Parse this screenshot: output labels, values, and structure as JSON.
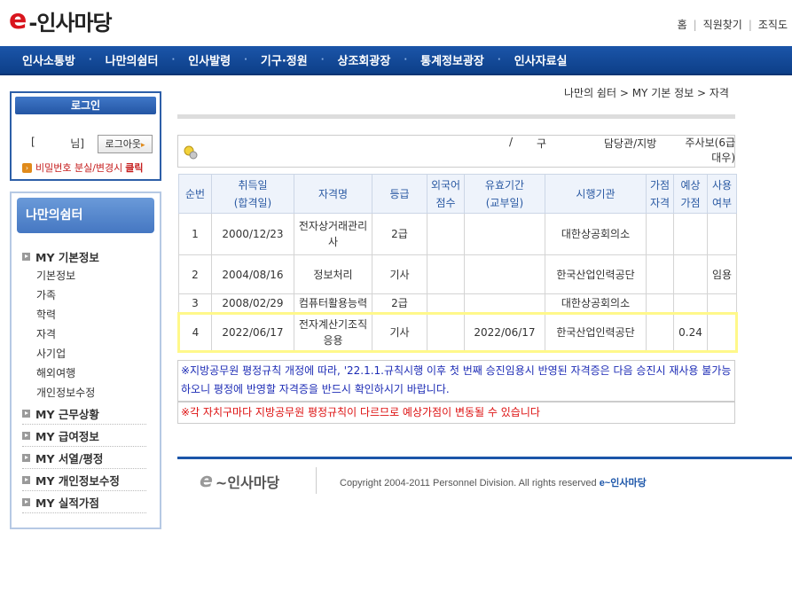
{
  "header": {
    "logo_e": "e",
    "logo_text": "-인사마당",
    "links": [
      "홈",
      "직원찾기",
      "조직도"
    ]
  },
  "gnb": [
    "인사소통방",
    "나만의쉼터",
    "인사발령",
    "기구·정원",
    "상조회광장",
    "통계정보광장",
    "인사자료실"
  ],
  "login": {
    "title": "로그인",
    "bracket_open": "[",
    "suffix": "님]",
    "logout": "로그아웃",
    "pw_text": "비밀번호 분실/변경시",
    "pw_click": "클릭"
  },
  "side": {
    "title": "나만의쉼터",
    "section1": "MY 기본정보",
    "subs": [
      "기본정보",
      "가족",
      "학력",
      "자격",
      "사기업",
      "해외여행",
      "개인정보수정"
    ],
    "sections": [
      "MY 근무상황",
      "MY 급여정보",
      "MY 서열/평정",
      "MY 개인정보수정",
      "MY 실적가점"
    ]
  },
  "breadcrumb": "나만의 쉼터 > MY 기본 정보 > 자격",
  "info": {
    "slash": "/",
    "gu": "구",
    "dept": "담당관/지방",
    "rank": "주사보(6급 대우)"
  },
  "table": {
    "headers": [
      "순번",
      "취득일\n(합격일)",
      "자격명",
      "등급",
      "외국어\n점수",
      "유효기간\n(교부일)",
      "시행기관",
      "가점\n자격",
      "예상\n가점",
      "사용\n여부"
    ],
    "rows": [
      [
        "1",
        "2000/12/23",
        "전자상거래관리사",
        "2급",
        "",
        "",
        "대한상공회의소",
        "",
        "",
        ""
      ],
      [
        "2",
        "2004/08/16",
        "정보처리",
        "기사",
        "",
        "",
        "한국산업인력공단",
        "",
        "",
        "임용"
      ],
      [
        "3",
        "2008/02/29",
        "컴퓨터활용능력",
        "2급",
        "",
        "",
        "대한상공회의소",
        "",
        "",
        ""
      ],
      [
        "4",
        "2022/06/17",
        "전자계산기조직응용",
        "기사",
        "",
        "2022/06/17",
        "한국산업인력공단",
        "",
        "0.24",
        ""
      ]
    ]
  },
  "notice1": "※지방공무원 평정규칙 개정에 따라, '22.1.1.규칙시행 이후 첫 번째 승진임용시 반영된 자격증은 다음 승진시 재사용 불가능하오니 평정에 반영할 자격증을 반드시 확인하시기 바랍니다.",
  "notice2": "※각 자치구마다 지방공무원 평정규칙이 다르므로 예상가점이 변동될 수 있습니다",
  "footer": {
    "logo_e": "e",
    "logo_text": "~인사마당",
    "copyright": "Copyright 2004-2011 Personnel Division. All rights reserved",
    "brand": "e~인사마당"
  },
  "colors": {
    "brand_red": "#d9151d",
    "nav_blue": "#1b55a9",
    "highlight": "#fff88a",
    "notice_blue": "#1c2bb5",
    "notice_red": "#dd1111"
  }
}
